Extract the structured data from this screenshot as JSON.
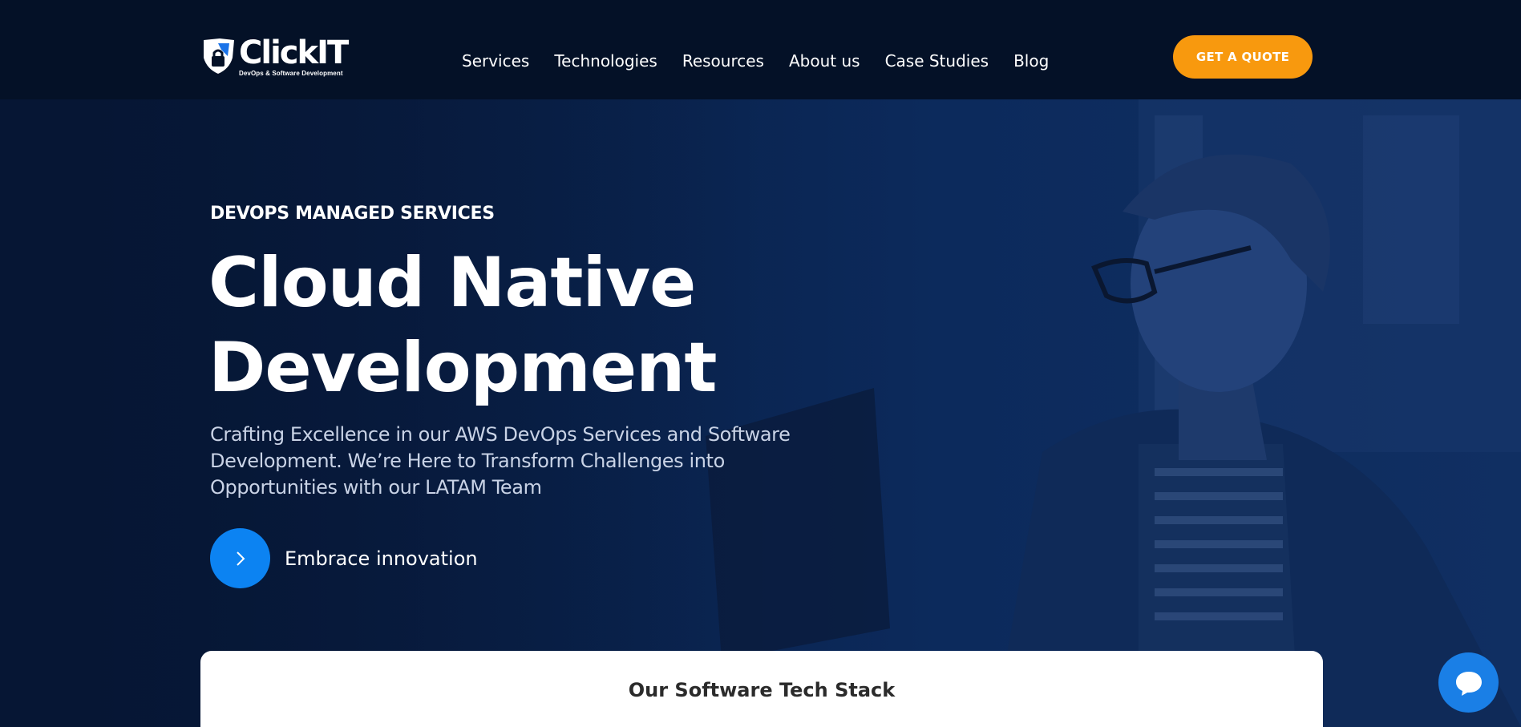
{
  "brand": {
    "name": "ClickIT",
    "tagline": "DevOps & Software Development"
  },
  "nav": {
    "items": [
      {
        "label": "Services"
      },
      {
        "label": "Technologies"
      },
      {
        "label": "Resources"
      },
      {
        "label": "About us"
      },
      {
        "label": "Case Studies"
      },
      {
        "label": "Blog"
      }
    ],
    "cta_label": "GET A QUOTE"
  },
  "hero": {
    "eyebrow": "DEVOPS MANAGED SERVICES",
    "title_line1": "Cloud Native",
    "title_line2": "Development",
    "subtitle": "Crafting Excellence in our AWS DevOps Services and Software Development. We’re Here to Transform Challenges into Opportunities with our LATAM Team",
    "cta_label": "Embrace innovation",
    "cta_icon": "chevron-right-icon"
  },
  "tech_stack": {
    "title": "Our Software Tech Stack"
  },
  "chat": {
    "icon": "chat-bubble-icon"
  },
  "colors": {
    "header_bg": "#041127",
    "hero_bg": "#0a2450",
    "accent_orange": "#f8990e",
    "accent_blue": "#0c83f2",
    "chat_blue": "#1a7fe6",
    "card_bg": "#ffffff"
  }
}
